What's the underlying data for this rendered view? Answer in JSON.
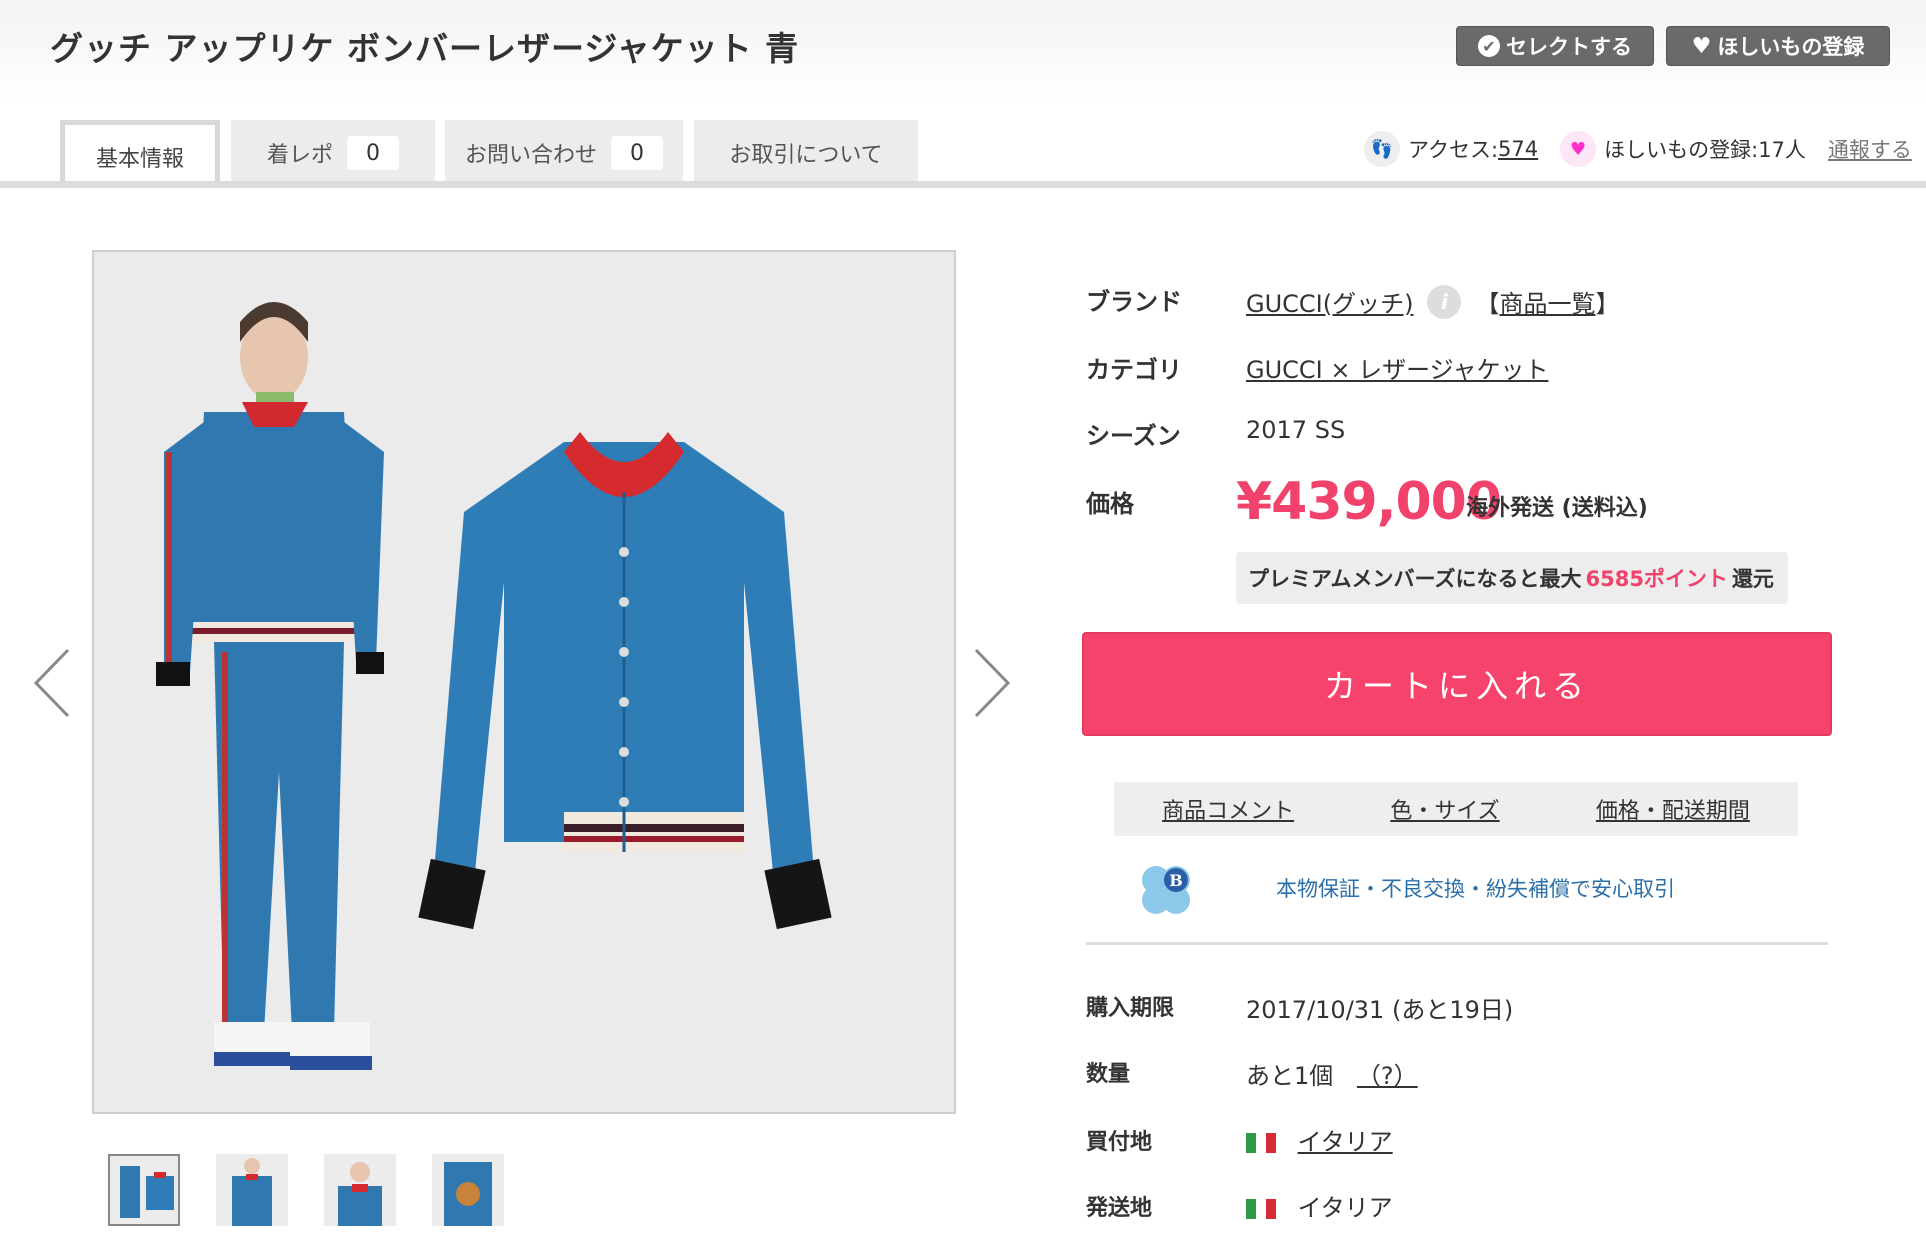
{
  "header": {
    "title": "グッチ アップリケ ボンバーレザージャケット 青",
    "select_label": "セレクトする",
    "wish_label": "ほしいもの登録"
  },
  "tabs": [
    {
      "label": "基本情報"
    },
    {
      "label": "着レポ",
      "count": "0"
    },
    {
      "label": "お問い合わせ",
      "count": "0"
    },
    {
      "label": "お取引について"
    }
  ],
  "stats": {
    "access_label": "アクセス: ",
    "access_count": "574",
    "wish_text": "ほしいもの登録:17人",
    "report_label": "通報する"
  },
  "details": {
    "brand_label": "ブランド",
    "brand_value": "GUCCI(グッチ)",
    "brand_list": "商品一覧",
    "category_label": "カテゴリ",
    "category_value": "GUCCI × レザージャケット",
    "season_label": "シーズン",
    "season_value": "2017 SS",
    "price_label": "価格",
    "price_value": "¥439,000",
    "shipping_note": "海外発送 (送料込)",
    "premium_prefix": "プレミアムメンバーズになると最大",
    "premium_points": "6585ポイント",
    "premium_suffix": "還元",
    "cart_label": "カートに入れる",
    "subtabs": [
      "商品コメント",
      "色・サイズ",
      "価格・配送期間"
    ],
    "guarantee_text": "本物保証・不良交換・紛失補償で安心取引",
    "deadline_label": "購入期限",
    "deadline_value": "2017/10/31 (あと19日)",
    "quantity_label": "数量",
    "quantity_value": "あと1個",
    "quantity_help": "（?）",
    "buy_location_label": "買付地",
    "buy_location_value": "イタリア",
    "ship_from_label": "発送地",
    "ship_from_value": "イタリア"
  },
  "colors": {
    "accent": "#f5436b",
    "price": "#f0426b",
    "link_blue": "#2b6fa8"
  }
}
